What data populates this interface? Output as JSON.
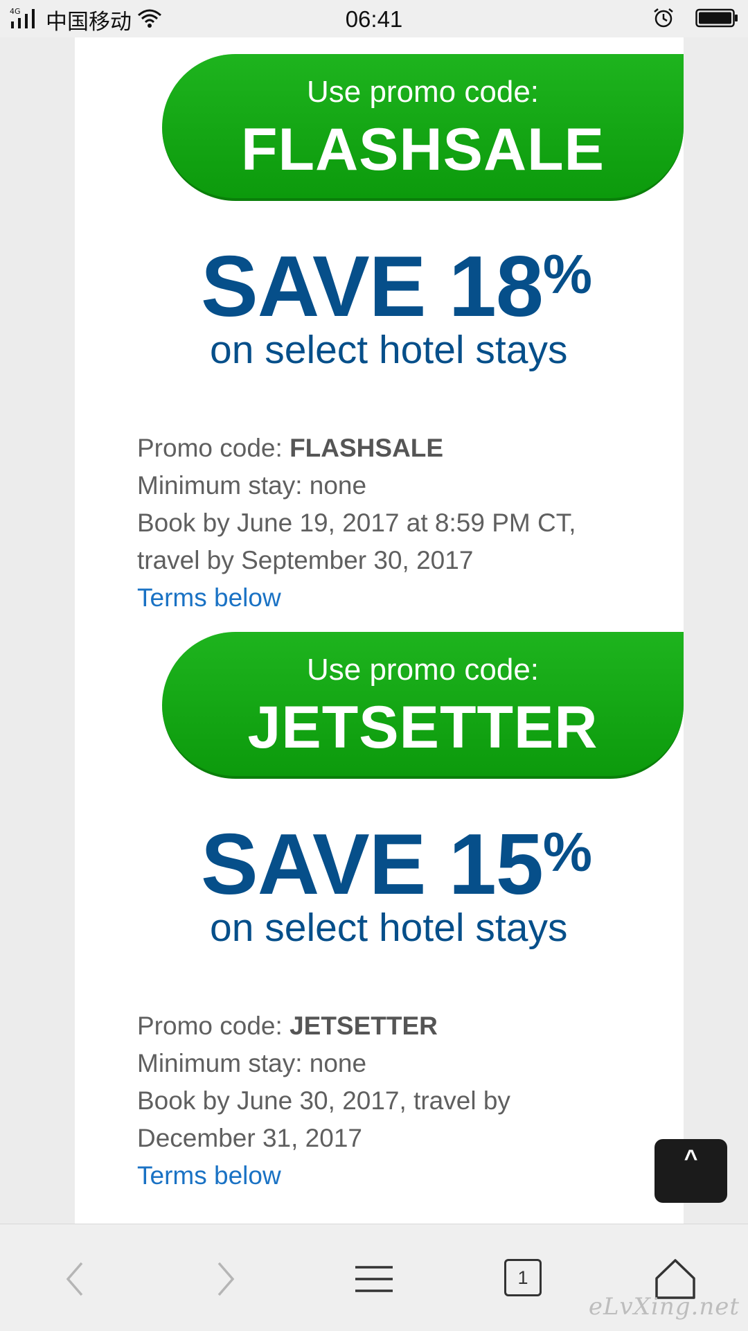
{
  "status_bar": {
    "network": "4G",
    "carrier": "中国移动",
    "time": "06:41"
  },
  "offers": [
    {
      "pill_label": "Use promo code:",
      "pill_code": "FLASHSALE",
      "save_text": "SAVE 18",
      "save_pct": "%",
      "save_sub": "on select hotel stays",
      "promo_label": "Promo code: ",
      "promo_value": "FLASHSALE",
      "min_stay": "Minimum stay: none",
      "book_line1": "Book by June 19, 2017 at 8:59 PM CT,",
      "book_line2": "travel by September 30, 2017",
      "terms": "Terms below"
    },
    {
      "pill_label": "Use promo code:",
      "pill_code": "JETSETTER",
      "save_text": "SAVE 15",
      "save_pct": "%",
      "save_sub": "on select hotel stays",
      "promo_label": "Promo code: ",
      "promo_value": "JETSETTER",
      "min_stay": "Minimum stay: none",
      "book_line1": "Book by June 30, 2017, travel by",
      "book_line2": "December 31, 2017",
      "terms": "Terms below"
    }
  ],
  "back_to_top_label": "^",
  "toolbar": {
    "tab_count": "1"
  },
  "watermark": "eLvXing.net",
  "colors": {
    "promo_green": "#14a814",
    "headline_blue": "#064f8a",
    "link_blue": "#1a72c4"
  }
}
